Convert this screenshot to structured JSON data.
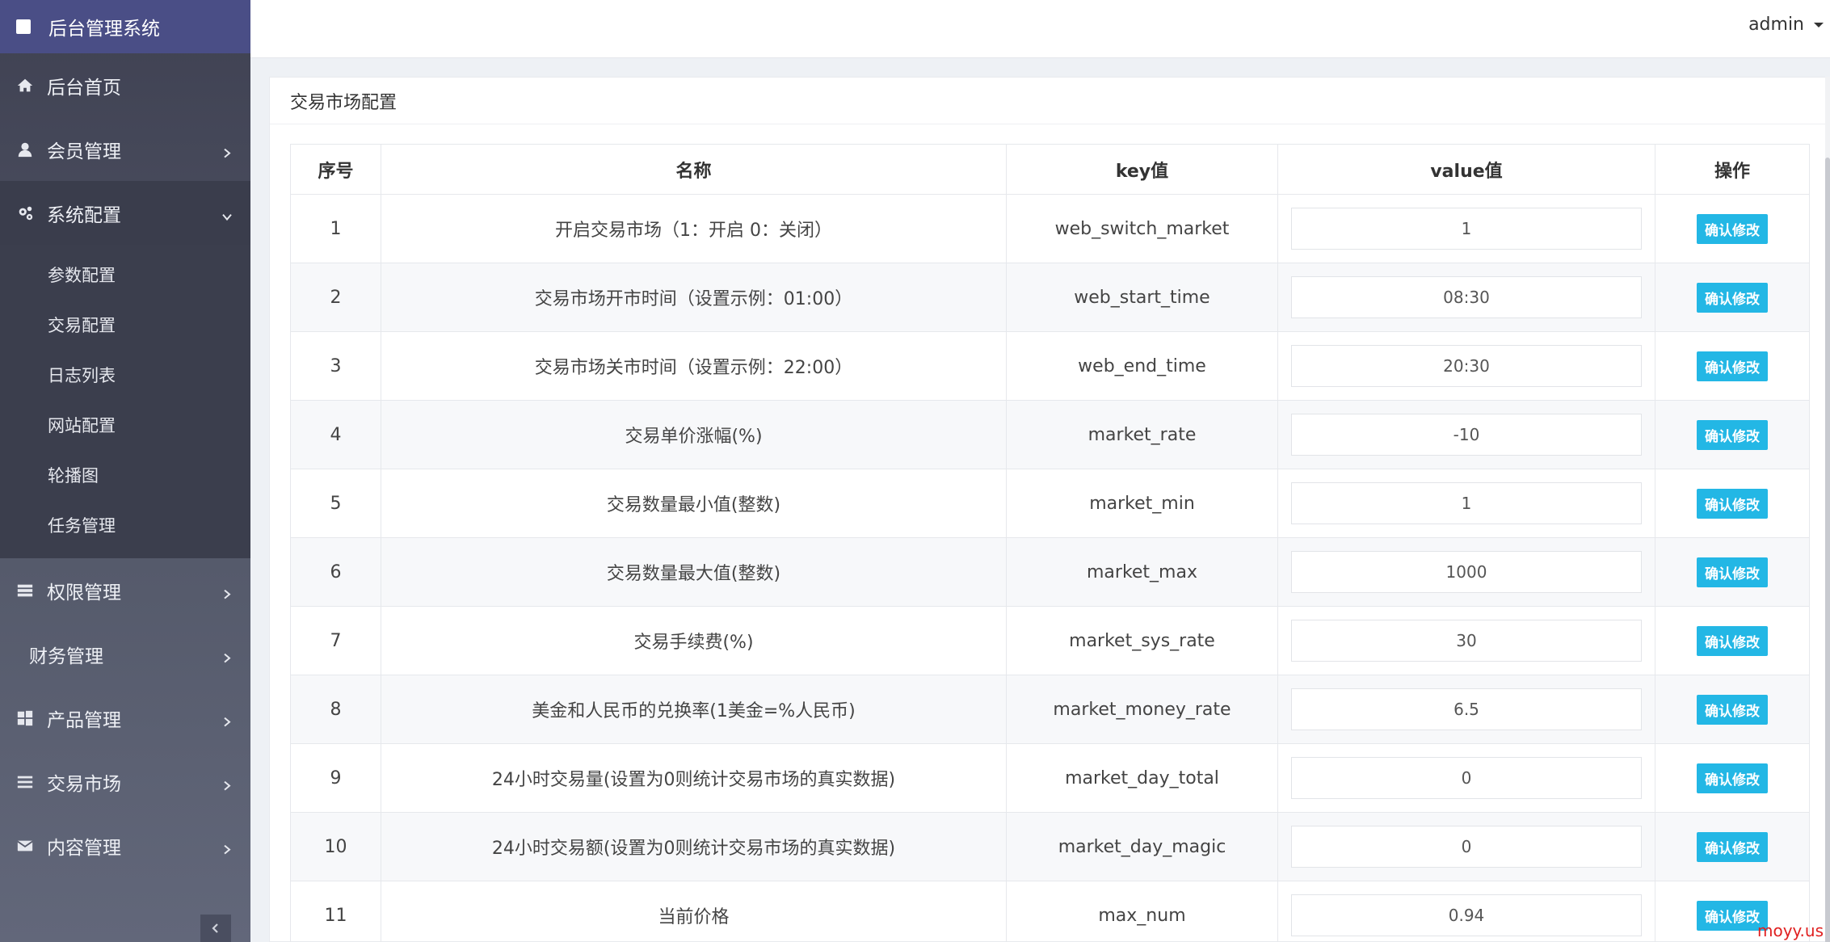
{
  "sidebar": {
    "brand": "后台管理系统",
    "items": [
      {
        "label": "后台首页",
        "icon": "home-icon",
        "chevron": false
      },
      {
        "label": "会员管理",
        "icon": "user-icon",
        "chevron": true
      },
      {
        "label": "系统配置",
        "icon": "gears-icon",
        "chevron": true,
        "expanded": true
      },
      {
        "label": "权限管理",
        "icon": "list-icon",
        "chevron": true
      },
      {
        "label": "财务管理",
        "icon": "",
        "chevron": true
      },
      {
        "label": "产品管理",
        "icon": "windows-icon",
        "chevron": true
      },
      {
        "label": "交易市场",
        "icon": "bars-icon",
        "chevron": true
      },
      {
        "label": "内容管理",
        "icon": "envelope-icon",
        "chevron": true
      }
    ],
    "subitems": [
      "参数配置",
      "交易配置",
      "日志列表",
      "网站配置",
      "轮播图",
      "任务管理"
    ]
  },
  "header": {
    "user": "admin"
  },
  "panel": {
    "title": "交易市场配置"
  },
  "table": {
    "headers": [
      "序号",
      "名称",
      "key值",
      "value值",
      "操作"
    ],
    "action_label": "确认修改",
    "rows": [
      {
        "id": "1",
        "name": "开启交易市场（1：开启 0：关闭）",
        "key": "web_switch_market",
        "value": "1"
      },
      {
        "id": "2",
        "name": "交易市场开市时间（设置示例：01:00）",
        "key": "web_start_time",
        "value": "08:30"
      },
      {
        "id": "3",
        "name": "交易市场关市时间（设置示例：22:00）",
        "key": "web_end_time",
        "value": "20:30"
      },
      {
        "id": "4",
        "name": "交易单价涨幅(%)",
        "key": "market_rate",
        "value": "-10"
      },
      {
        "id": "5",
        "name": "交易数量最小值(整数)",
        "key": "market_min",
        "value": "1"
      },
      {
        "id": "6",
        "name": "交易数量最大值(整数)",
        "key": "market_max",
        "value": "1000"
      },
      {
        "id": "7",
        "name": "交易手续费(%)",
        "key": "market_sys_rate",
        "value": "30"
      },
      {
        "id": "8",
        "name": "美金和人民币的兑换率(1美金=%人民币)",
        "key": "market_money_rate",
        "value": "6.5"
      },
      {
        "id": "9",
        "name": "24小时交易量(设置为0则统计交易市场的真实数据)",
        "key": "market_day_total",
        "value": "0"
      },
      {
        "id": "10",
        "name": "24小时交易额(设置为0则统计交易市场的真实数据)",
        "key": "market_day_magic",
        "value": "0"
      },
      {
        "id": "11",
        "name": "当前价格",
        "key": "max_num",
        "value": "0.94"
      }
    ]
  },
  "watermark": "moyy.us",
  "colors": {
    "accent": "#23b7e5",
    "brand_bar": "#4a4e86",
    "sidebar": "#4a4d5e"
  }
}
